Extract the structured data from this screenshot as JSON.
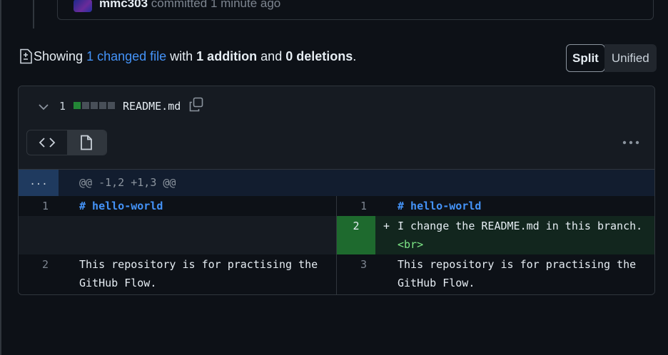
{
  "commit": {
    "author": "mmc303",
    "action": "committed",
    "time": "1 minute ago"
  },
  "summary": {
    "prefix": "Showing ",
    "files_link": "1 changed file",
    "mid1": " with ",
    "additions": "1 addition",
    "mid2": " and ",
    "deletions": "0 deletions",
    "suffix": "."
  },
  "view_mode": {
    "split": "Split",
    "unified": "Unified"
  },
  "file": {
    "change_count": "1",
    "name": "README.md",
    "blocks": [
      "#238636",
      "#484f58",
      "#484f58",
      "#484f58",
      "#484f58"
    ]
  },
  "hunk": {
    "expander": "...",
    "header": "@@ -1,2 +1,3 @@"
  },
  "diff": {
    "left": [
      {
        "num": "1",
        "text": "# hello-world"
      },
      {
        "num": "2",
        "text_line1": "This repository is for practising the",
        "text_line2": "GitHub Flow."
      }
    ],
    "right": [
      {
        "num": "1",
        "text": "# hello-world"
      },
      {
        "num": "2",
        "marker": "+",
        "text_line1": "I change the README.md in this branch.",
        "text_line2": "<br>"
      },
      {
        "num": "3",
        "text_line1": "This repository is for practising the",
        "text_line2": "GitHub Flow."
      }
    ]
  }
}
